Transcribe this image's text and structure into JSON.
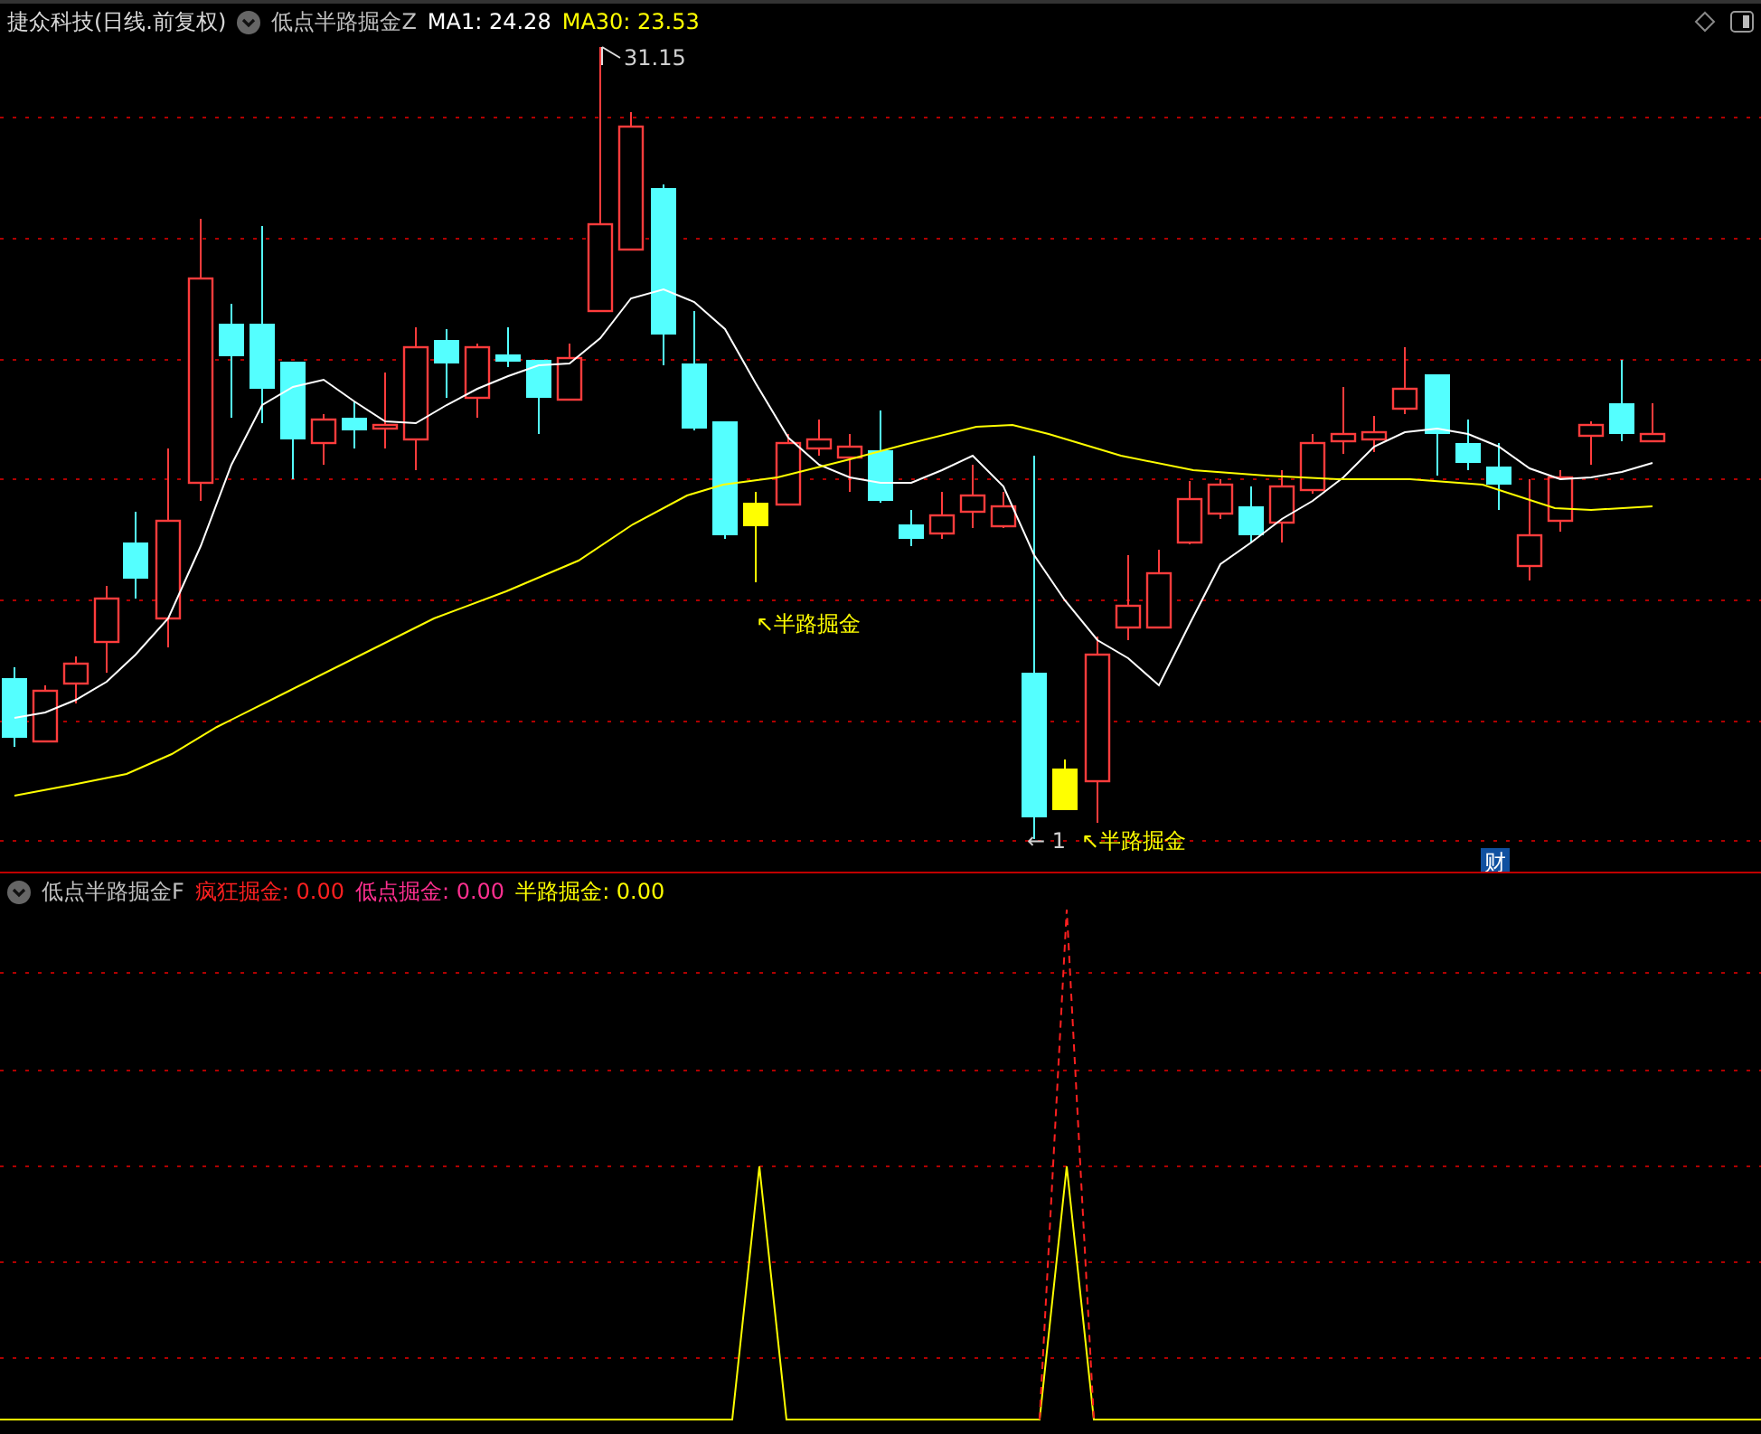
{
  "main_panel": {
    "title": "捷众科技(日线.前复权)",
    "indicator": "低点半路掘金Z",
    "readings": [
      {
        "label": "MA1: 24.28",
        "color": "#ffffff"
      },
      {
        "label": "MA30: 23.53",
        "color": "#ffff00"
      }
    ],
    "annotations": [
      {
        "kind": "price",
        "text": "31.15"
      },
      {
        "kind": "signal",
        "text": "↖半路掘金"
      },
      {
        "kind": "price",
        "text": "← 1"
      },
      {
        "kind": "signal",
        "text": "↖半路掘金"
      }
    ],
    "badge": "财"
  },
  "sub_panel": {
    "indicator": "低点半路掘金F",
    "readings": [
      {
        "label": "疯狂掘金: 0.00",
        "color": "#ff2020"
      },
      {
        "label": "低点掘金: 0.00",
        "color": "#ff3090"
      },
      {
        "label": "半路掘金: 0.00",
        "color": "#ffff00"
      }
    ]
  }
}
